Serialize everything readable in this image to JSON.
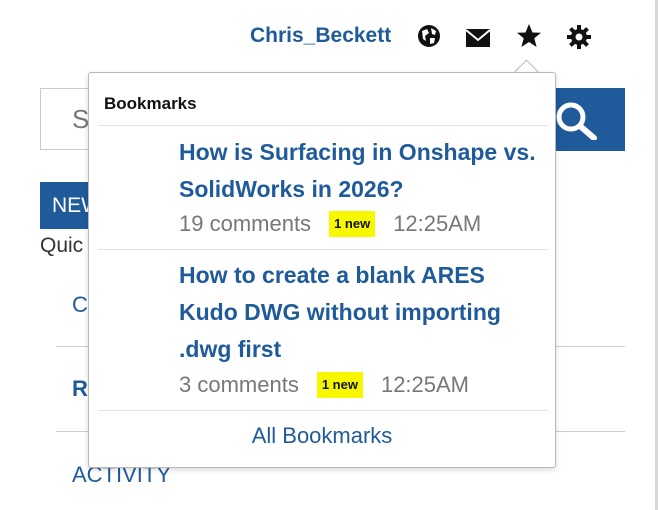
{
  "header": {
    "username": "Chris_Beckett"
  },
  "search": {
    "placeholder_fragment": "S"
  },
  "sidebar": {
    "new_button_fragment": "NEW",
    "quick_label_fragment": "Quic",
    "link_c_fragment": "C",
    "link_r_fragment": "R",
    "activity_label": "ACTIVITY"
  },
  "bookmarks": {
    "title": "Bookmarks",
    "items": [
      {
        "title": "How is Surfacing in Onshape vs. SolidWorks in 2026?",
        "comments": "19 comments",
        "badge": "1 new",
        "time": "12:25AM"
      },
      {
        "title": "How to create a blank ARES Kudo DWG without importing .dwg first",
        "comments": "3 comments",
        "badge": "1 new",
        "time": "12:25AM"
      }
    ],
    "all_link": "All Bookmarks"
  },
  "colors": {
    "accent": "#1f5a9b",
    "badge": "#f7f700"
  }
}
